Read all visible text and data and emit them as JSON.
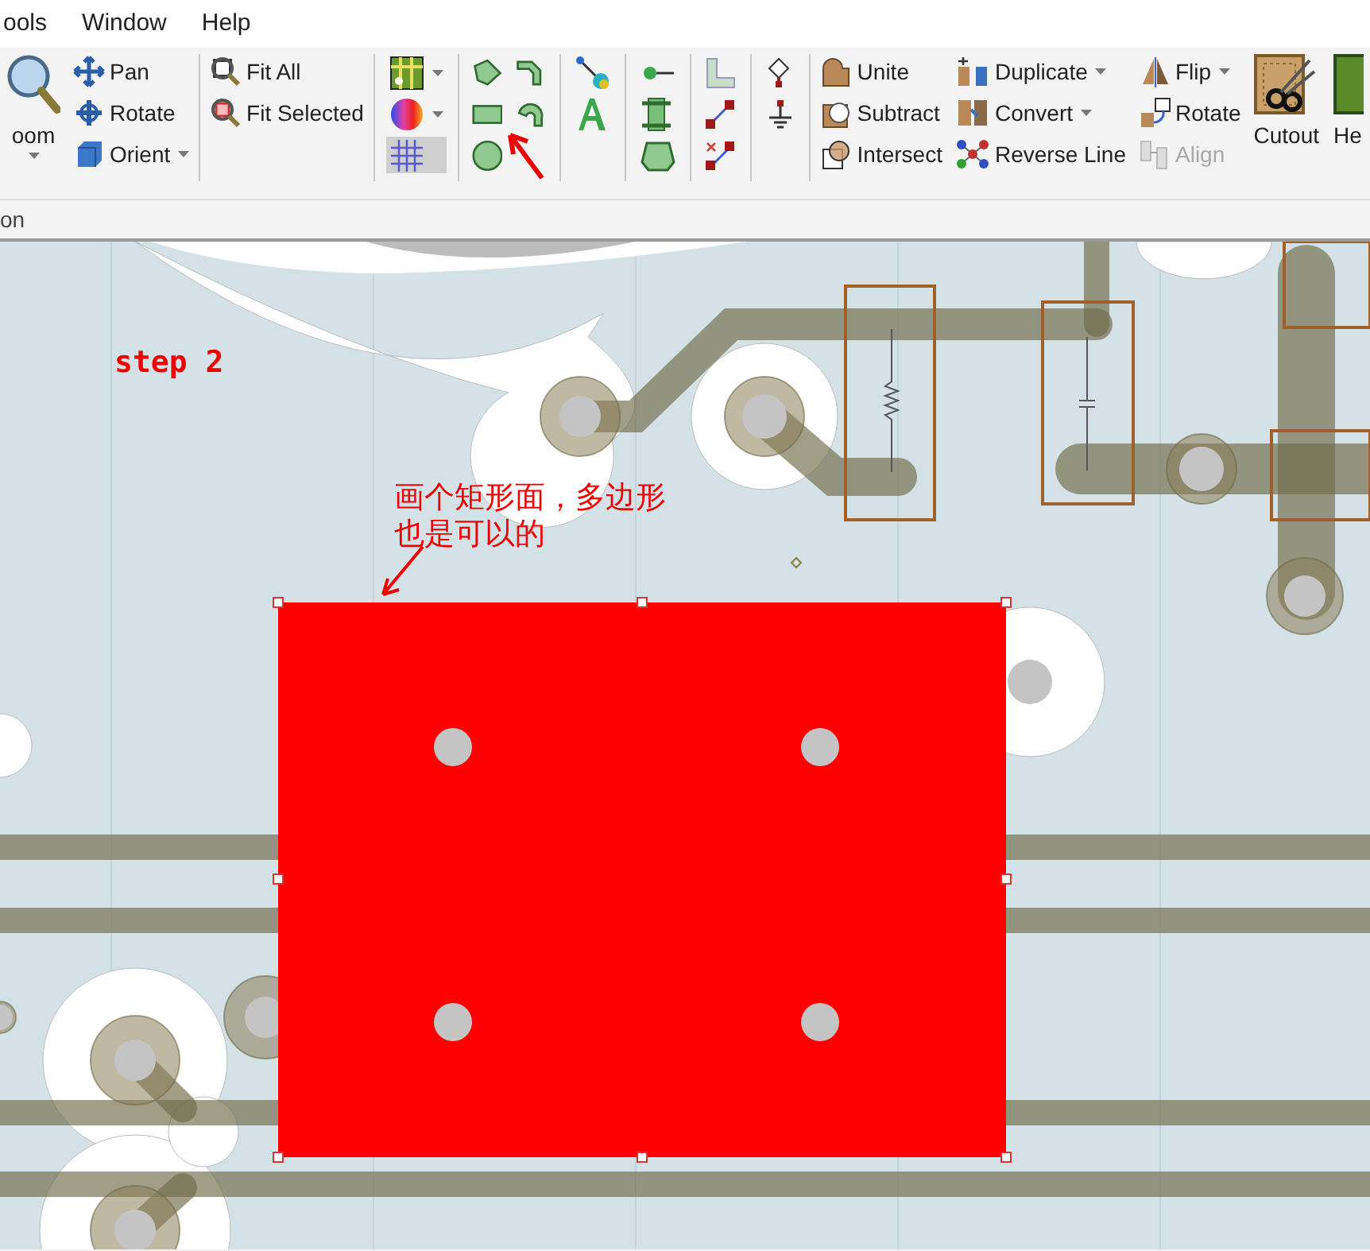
{
  "menu": [
    {
      "label": "ools"
    },
    {
      "label": "Window"
    },
    {
      "label": "Help"
    }
  ],
  "ribbon": {
    "groups": [
      {
        "columns": [
          {
            "kind": "large",
            "items": [
              {
                "label": "oom",
                "dropdown": true
              }
            ]
          },
          {
            "kind": "small",
            "items": [
              {
                "label": "Pan",
                "dropdown": false
              },
              {
                "label": "Rotate",
                "dropdown": false
              },
              {
                "label": "Orient",
                "dropdown": true
              }
            ]
          }
        ]
      },
      {
        "columns": [
          {
            "kind": "small",
            "items": [
              {
                "label": "Fit All",
                "dropdown": false
              },
              {
                "label": "Fit Selected",
                "dropdown": false
              }
            ]
          }
        ]
      },
      {
        "columns": [
          {
            "kind": "icons",
            "items": [
              {
                "dropdown": true,
                "selected": false
              },
              {
                "dropdown": true,
                "selected": false
              },
              {
                "dropdown": false,
                "selected": true
              }
            ]
          }
        ]
      },
      {
        "columns": [
          {
            "kind": "grid",
            "items": [
              {
                "selected": false
              },
              {
                "selected": false
              },
              {
                "selected": false
              },
              {
                "selected": false
              },
              {
                "selected": false
              }
            ]
          }
        ]
      },
      {
        "columns": [
          {
            "kind": "icons",
            "items": [
              {
                "dropdown": false,
                "selected": false
              },
              {
                "dropdown": false,
                "selected": false
              }
            ]
          }
        ]
      },
      {
        "columns": [
          {
            "kind": "icons",
            "items": [
              {
                "dropdown": false,
                "selected": false
              },
              {
                "dropdown": false,
                "selected": false
              },
              {
                "dropdown": false,
                "selected": false
              }
            ]
          }
        ]
      },
      {
        "columns": [
          {
            "kind": "icons",
            "items": [
              {
                "dropdown": false,
                "selected": false
              },
              {
                "dropdown": false,
                "selected": false
              },
              {
                "dropdown": false,
                "selected": false
              }
            ]
          }
        ]
      },
      {
        "columns": [
          {
            "kind": "icons",
            "items": [
              {
                "dropdown": false,
                "selected": false
              },
              {
                "dropdown": false,
                "selected": false
              }
            ]
          }
        ]
      },
      {
        "columns": [
          {
            "kind": "small",
            "items": [
              {
                "label": "Unite",
                "dropdown": false,
                "disabled": false
              },
              {
                "label": "Subtract",
                "dropdown": false,
                "disabled": false
              },
              {
                "label": "Intersect",
                "dropdown": false,
                "disabled": false
              }
            ]
          },
          {
            "kind": "small",
            "items": [
              {
                "label": "Duplicate",
                "dropdown": true,
                "disabled": false
              },
              {
                "label": "Convert",
                "dropdown": true,
                "disabled": false
              },
              {
                "label": "Reverse Line",
                "dropdown": false,
                "disabled": false
              }
            ]
          },
          {
            "kind": "small",
            "items": [
              {
                "label": "Flip",
                "dropdown": true,
                "disabled": false
              },
              {
                "label": "Rotate",
                "dropdown": false,
                "disabled": false
              },
              {
                "label": "Align",
                "dropdown": false,
                "disabled": true
              }
            ]
          },
          {
            "kind": "large",
            "items": [
              {
                "label": "Cutout",
                "dropdown": false
              }
            ]
          },
          {
            "kind": "large",
            "items": [
              {
                "label": "He",
                "dropdown": false
              }
            ]
          }
        ]
      }
    ]
  },
  "ribbon_group_label": "on",
  "canvas": {
    "step_label": "step 2",
    "note": "画个矩形面，多边形也是可以的"
  }
}
